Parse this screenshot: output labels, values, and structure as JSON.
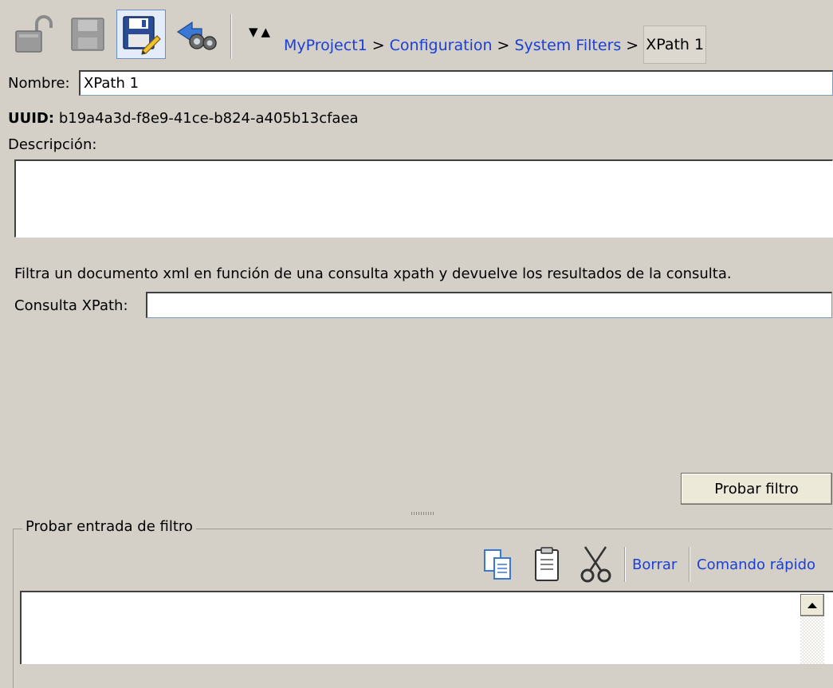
{
  "toolbar": {
    "icons": {
      "unlock": "unlock-icon",
      "save_disabled": "save-disabled-icon",
      "save_as": "save-as-icon",
      "find": "binoculars-icon",
      "nav_down": "triangle-down-icon",
      "nav_up": "triangle-up-icon"
    },
    "nav_glyphs": "▼ ▲"
  },
  "breadcrumb": {
    "items": [
      "MyProject1",
      "Configuration",
      "System Filters"
    ],
    "separator": ">",
    "current": "XPath 1"
  },
  "form": {
    "name_label": "Nombre:",
    "name_value": "XPath 1",
    "uuid_label": "UUID:",
    "uuid_value": "b19a4a3d-f8e9-41ce-b824-a405b13cfaea",
    "description_label": "Descripción:",
    "description_value": "",
    "filter_description": "Filtra un documento xml en función de una consulta xpath y devuelve los resultados de la consulta.",
    "xpath_label": "Consulta XPath:",
    "xpath_value": ""
  },
  "actions": {
    "test_filter": "Probar filtro"
  },
  "test_input": {
    "group_title": "Probar entrada de filtro",
    "clear_label": "Borrar",
    "quick_command_label": "Comando rápido",
    "icons": {
      "copy": "copy-icon",
      "paste": "paste-icon",
      "cut": "scissors-icon",
      "scroll_up": "scroll-up-arrow-icon"
    },
    "value": ""
  },
  "colors": {
    "background": "#d4d0c8",
    "link": "#1a3fd6"
  }
}
